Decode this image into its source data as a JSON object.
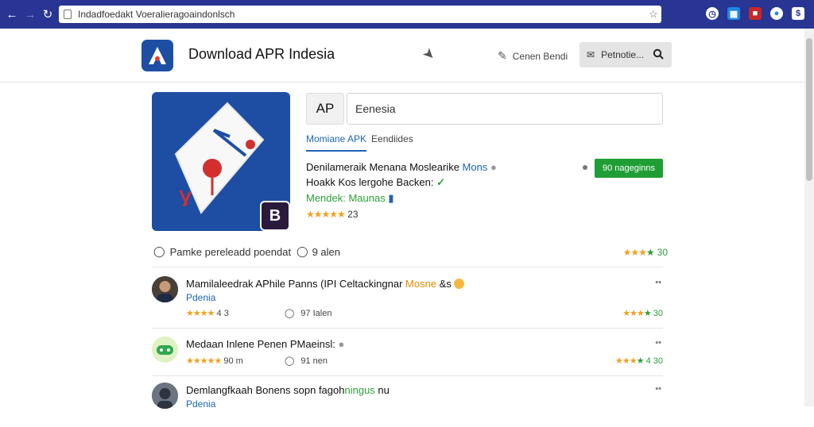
{
  "browser": {
    "url": "Indadfoedakt Voeralieragoaindonlsch"
  },
  "header": {
    "site_title": "Download APR Indesia",
    "link_label": "Cenen Bendi",
    "button_label": "Petnotie..."
  },
  "app": {
    "badge_letter": "B",
    "ap_label": "AP",
    "search_value": "Eenesia",
    "tab_active": "Momiane APK",
    "tab_other": "Eendiides",
    "line1_a": "Denilameraik Menana Moslearike",
    "line1_b": "Mons",
    "line2": "Hoakk Kos lergohe Backen:",
    "line3_a": "Mendek: Maunas",
    "rating_value": "23",
    "download_label": "90 nageginns"
  },
  "summary": {
    "left_text": "Pamke pereleadd poendat",
    "mid_text": "9 alen",
    "rating_value": "30"
  },
  "reviews": [
    {
      "title_a": "Mamilaleedrak APhile Panns (IPI Celtackingnar ",
      "title_b": "Mosne",
      "title_c": " &s",
      "subtitle": "Pdenia",
      "stars_value": "4 3",
      "comments": "97 Ialen",
      "rating_value": "30"
    },
    {
      "title_a": "Medaan Inlene Penen PMaeinsl:",
      "title_b": "",
      "title_c": "",
      "subtitle": "",
      "stars_value": "90 m",
      "comments": "91 nen",
      "rating_value": "4 30"
    },
    {
      "title_a": "Demlangfkaah Bonens sopn fagoh",
      "title_b": "ningus",
      "title_c": " nu",
      "subtitle": "Pdenia",
      "stars_value": "",
      "comments": "",
      "rating_value": ""
    }
  ],
  "colors": {
    "chrome": "#283593",
    "brand_blue": "#1d4ea3",
    "link_blue": "#1e63b5",
    "green": "#1f9e35",
    "star": "#f0a020"
  }
}
